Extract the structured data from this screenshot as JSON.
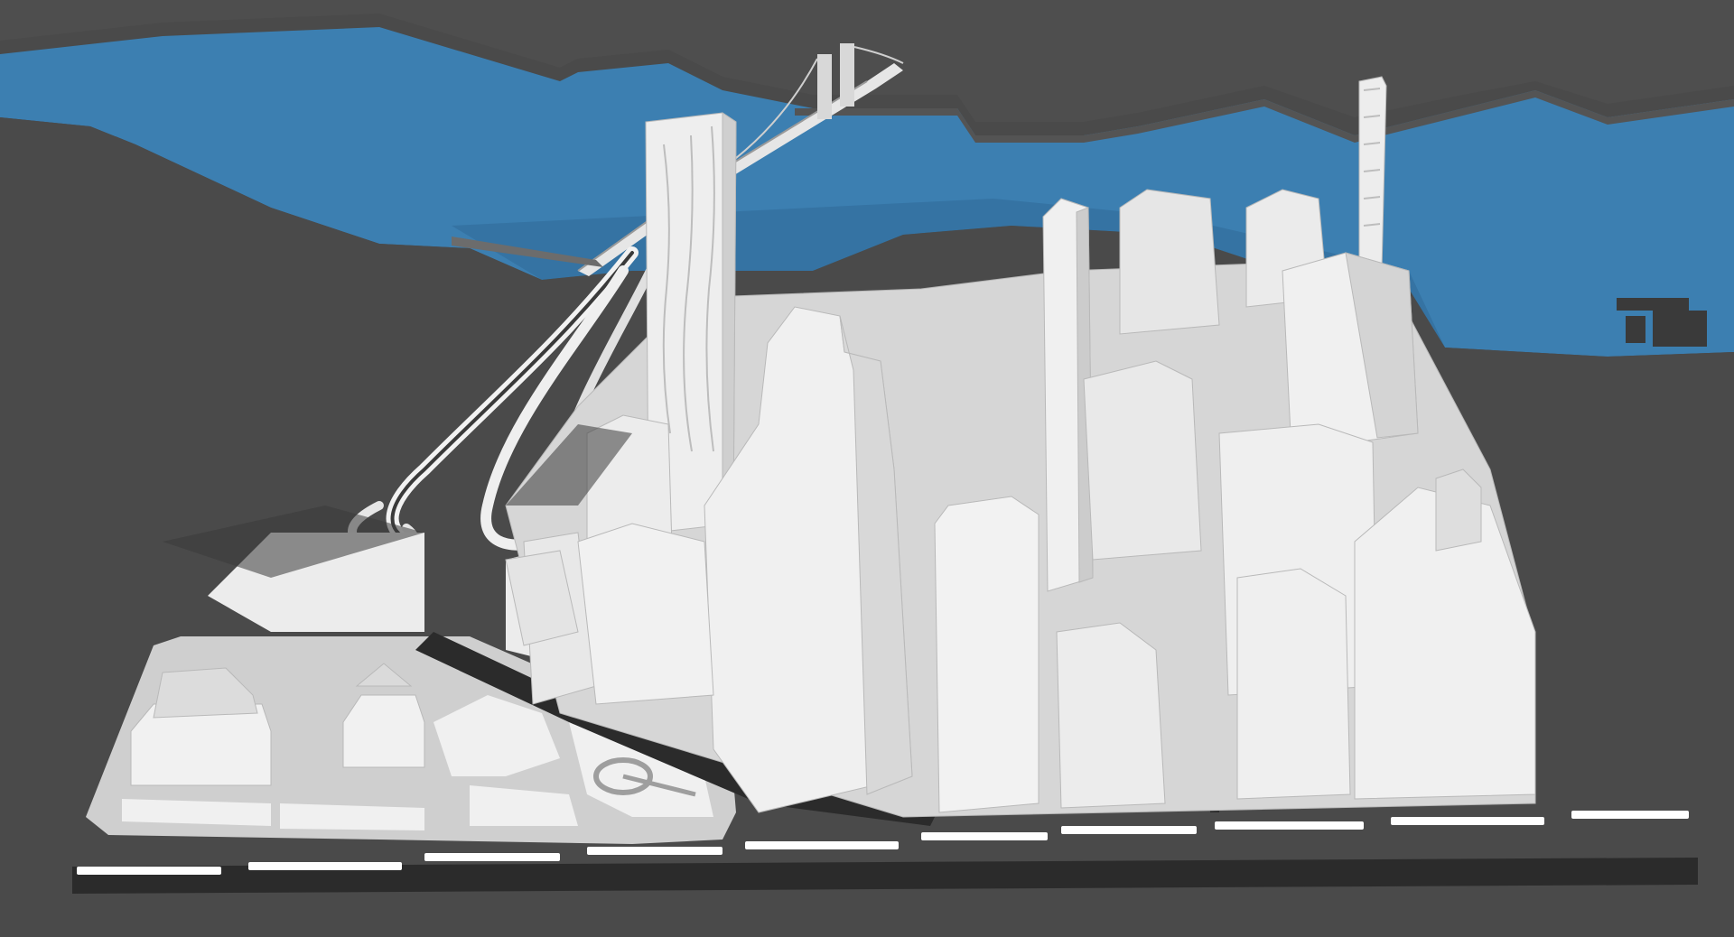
{
  "scene": {
    "subject": "3d-city-model-render",
    "palette": {
      "ground": "#4a4a4a",
      "ground_light": "#555555",
      "water": "#3c7fb1",
      "water_dark": "#2f6a97",
      "building_light": "#f1f1f1",
      "building_mid": "#dadada",
      "building_shadow": "#bdbdbd",
      "plaza": "#e9e9e9",
      "plaza_dark": "#c9c9c9",
      "road": "#2b2b2b",
      "lane_marking": "#ffffff"
    },
    "elements": [
      "river",
      "far-shore",
      "suspension-bridge",
      "elevated-ramps",
      "park-plaza",
      "low-civic-buildings",
      "skyscraper-cluster",
      "street-grid",
      "lane-markings",
      "pier"
    ]
  }
}
